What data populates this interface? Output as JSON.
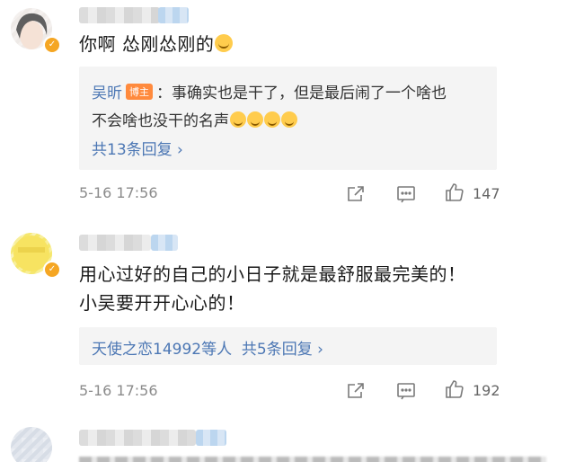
{
  "comments": [
    {
      "text_lines": [
        "你啊 怂刚怂刚的"
      ],
      "reply": {
        "author": "吴昕",
        "host_badge": "博主",
        "line1": "：事确实也是干了，但是最后闹了一个啥也",
        "line2": "不会啥也没干的名声",
        "more": "共13条回复 ›"
      },
      "time": "5-16 17:56",
      "likes": "147"
    },
    {
      "text_lines": [
        "用心过好的自己的小日子就是最舒服最完美的！",
        "小吴要开开心心的！"
      ],
      "reply_summary": {
        "liked_by": "天使之恋14992等人",
        "more": "共5条回复 ›"
      },
      "time": "5-16 17:56",
      "likes": "192"
    }
  ],
  "partial_third": {
    "text": ""
  },
  "icons": {
    "forward": "share-icon",
    "comment": "comment-icon",
    "like": "like-icon",
    "verified": "verified-badge-icon"
  },
  "colors": {
    "link": "#4c77b4",
    "host_badge": "#ff8a3d",
    "meta": "#8b8b8b"
  }
}
